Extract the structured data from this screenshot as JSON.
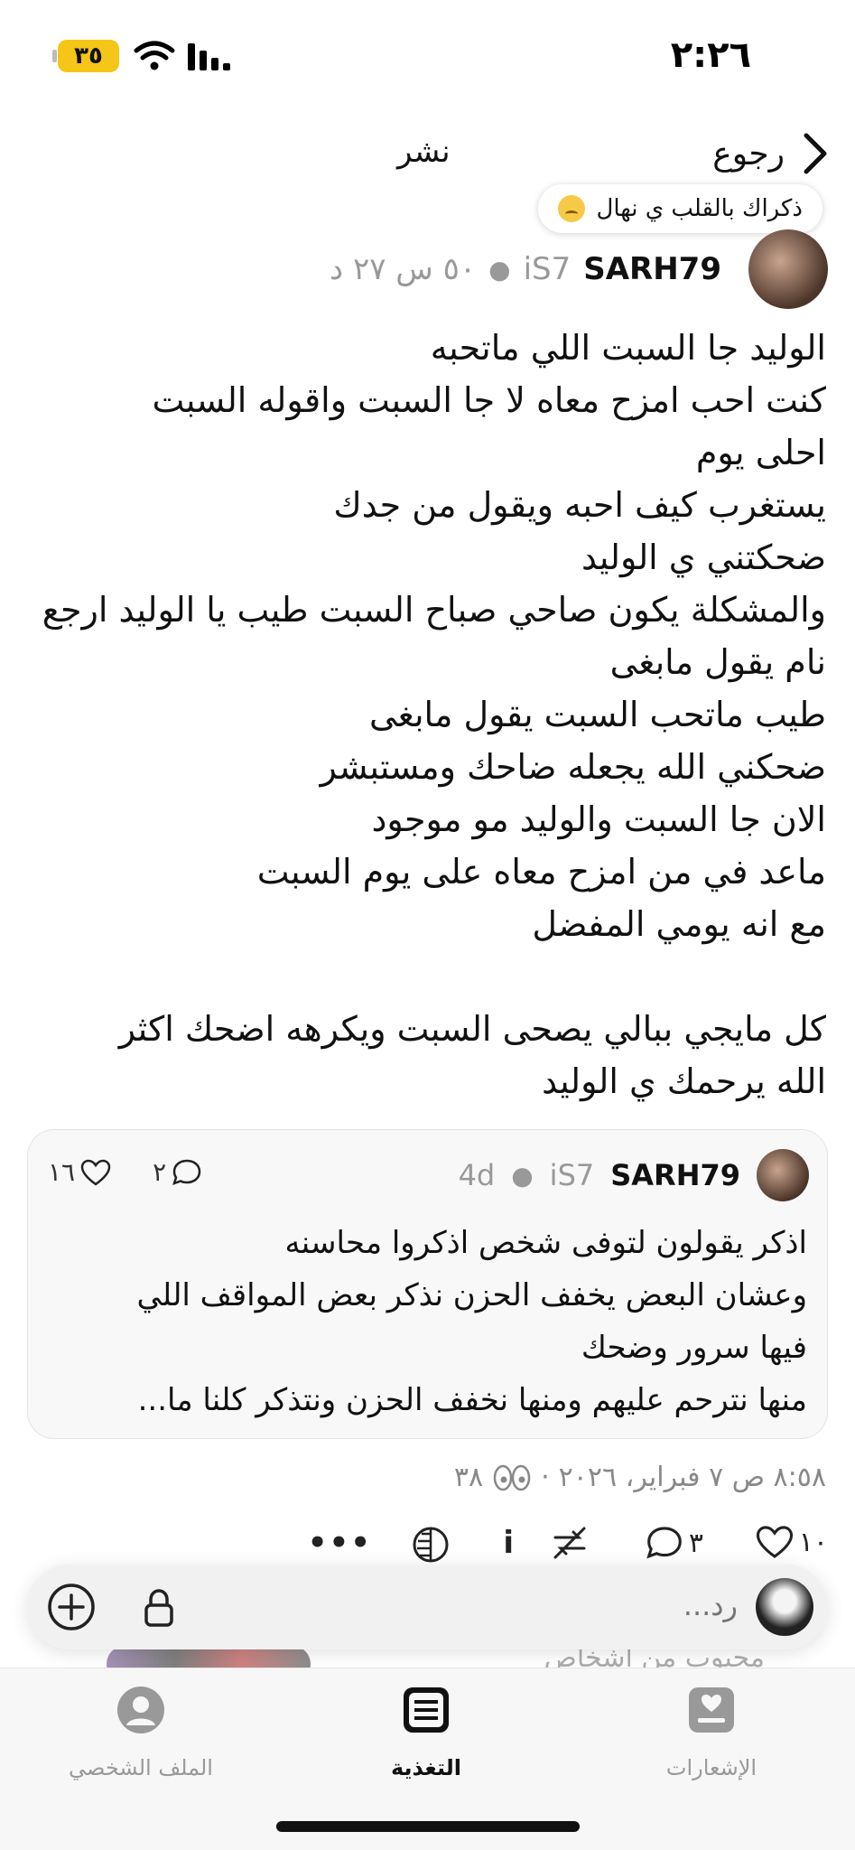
{
  "status_bar": {
    "time": "٢:٢٦",
    "battery": "٣٥"
  },
  "header": {
    "back_label": "رجوع",
    "title": "نشر"
  },
  "note": {
    "text": "ذكراك بالقلب ي نهال",
    "emoji": "sad-face-icon"
  },
  "post": {
    "username": "SARH79",
    "badge": "iS7",
    "meta": "٥٠ س ٢٧ د",
    "body": "الوليد جا السبت اللي ماتحبه\nكنت احب امزح معاه لا جا السبت واقوله السبت\nاحلى يوم\nيستغرب كيف احبه ويقول من جدك\nضحكتني ي الوليد\nوالمشكلة يكون صاحي صباح السبت طيب يا الوليد ارجع\nنام يقول مابغى\nطيب ماتحب السبت يقول مابغى\nضحكني الله يجعله ضاحك ومستبشر\nالان جا السبت والوليد مو موجود\nماعد في من امزح معاه على يوم السبت\nمع انه يومي المفضل\n\nكل مايجي ببالي يصحى السبت ويكرهه اضحك اكثر\nالله يرحمك ي الوليد"
  },
  "quote": {
    "username": "SARH79",
    "badge": "iS7",
    "age": "4d",
    "likes": "١٦",
    "replies": "٢",
    "body": "اذكر يقولون لتوفى شخص اذكروا محاسنه\nوعشان البعض يخفف الحزن نذكر بعض المواقف اللي\nفيها سرور وضحك\nمنها نترحم عليهم ومنها نخفف الحزن ونتذكر كلنا ما..."
  },
  "meta_line": {
    "datetime": "٨:٥٨ ص ٧ فبراير، ٢٠٢٦",
    "views": "٣٨"
  },
  "actions": {
    "likes": "١٠",
    "replies": "٣"
  },
  "reply_bar": {
    "placeholder": "رد..."
  },
  "liked_by": {
    "text": "محبوب من أشخاص"
  },
  "tabs": [
    {
      "label": "الإشعارات"
    },
    {
      "label": "التغذية"
    },
    {
      "label": "الملف الشخصي"
    }
  ]
}
